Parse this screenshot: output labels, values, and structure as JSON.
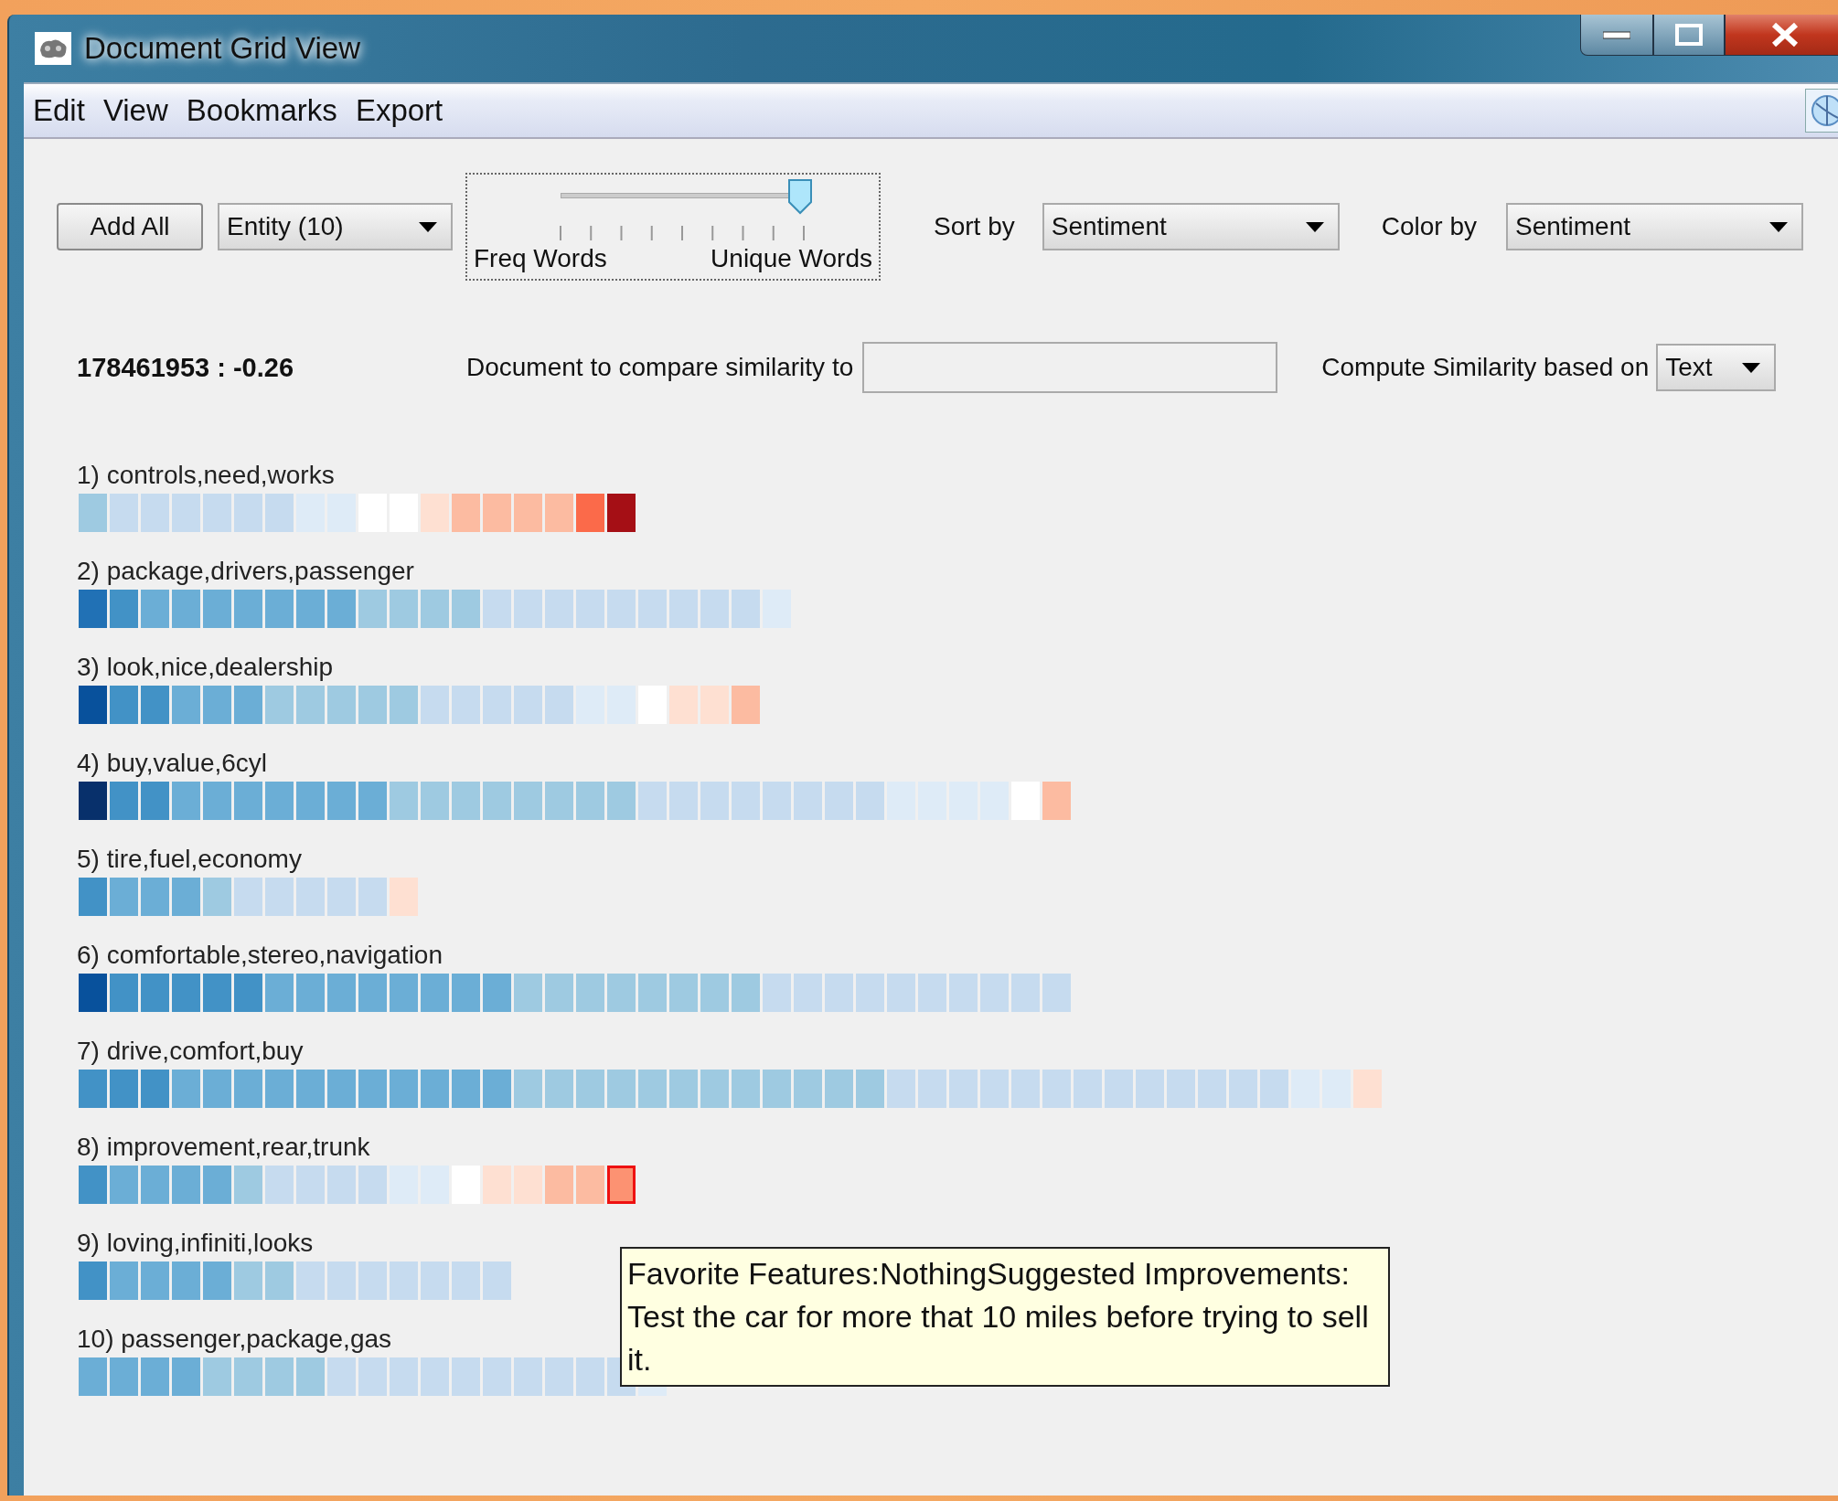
{
  "window": {
    "title": "Document Grid View"
  },
  "menu": [
    "Edit",
    "View",
    "Bookmarks",
    "Export"
  ],
  "toolbar": {
    "add_button": "Add All",
    "entity_dropdown": {
      "value": "Entity (10)"
    },
    "slider": {
      "left_label": "Freq Words",
      "right_label": "Unique Words",
      "level": 0.89
    },
    "sort_label": "Sort by",
    "sort_dropdown": {
      "value": "Sentiment"
    },
    "color_label": "Color by",
    "color_dropdown": {
      "value": "Sentiment"
    }
  },
  "info": {
    "document_score": "178461953 : -0.26",
    "compare_label": "Document to compare similarity to",
    "similarity_label": "Compute Similarity based on",
    "similarity_dropdown": {
      "value": "Text"
    }
  },
  "rows": [
    {
      "label": "1) controls,need,works",
      "cells": [
        {
          "color": "#9ecae1",
          "selected": false
        },
        {
          "color": "#c6dbef",
          "selected": false
        },
        {
          "color": "#c6dbef",
          "selected": false
        },
        {
          "color": "#c6dbef",
          "selected": false
        },
        {
          "color": "#c6dbef",
          "selected": false
        },
        {
          "color": "#c6dbef",
          "selected": false
        },
        {
          "color": "#c6dbef",
          "selected": false
        },
        {
          "color": "#deebf7",
          "selected": false
        },
        {
          "color": "#deebf7",
          "selected": false
        },
        {
          "color": "#ffffff",
          "selected": false
        },
        {
          "color": "#ffffff",
          "selected": false
        },
        {
          "color": "#fee0d2",
          "selected": false
        },
        {
          "color": "#fcbba1",
          "selected": false
        },
        {
          "color": "#fcbba1",
          "selected": false
        },
        {
          "color": "#fcbba1",
          "selected": false
        },
        {
          "color": "#fcbba1",
          "selected": false
        },
        {
          "color": "#fb6a4a",
          "selected": false
        },
        {
          "color": "#a50f15",
          "selected": false
        }
      ]
    },
    {
      "label": "2) package,drivers,passenger",
      "cells": [
        {
          "color": "#2171b5",
          "selected": false
        },
        {
          "color": "#4292c6",
          "selected": false
        },
        {
          "color": "#6baed6",
          "selected": false
        },
        {
          "color": "#6baed6",
          "selected": false
        },
        {
          "color": "#6baed6",
          "selected": false
        },
        {
          "color": "#6baed6",
          "selected": false
        },
        {
          "color": "#6baed6",
          "selected": false
        },
        {
          "color": "#6baed6",
          "selected": false
        },
        {
          "color": "#6baed6",
          "selected": false
        },
        {
          "color": "#9ecae1",
          "selected": false
        },
        {
          "color": "#9ecae1",
          "selected": false
        },
        {
          "color": "#9ecae1",
          "selected": false
        },
        {
          "color": "#9ecae1",
          "selected": false
        },
        {
          "color": "#c6dbef",
          "selected": false
        },
        {
          "color": "#c6dbef",
          "selected": false
        },
        {
          "color": "#c6dbef",
          "selected": false
        },
        {
          "color": "#c6dbef",
          "selected": false
        },
        {
          "color": "#c6dbef",
          "selected": false
        },
        {
          "color": "#c6dbef",
          "selected": false
        },
        {
          "color": "#c6dbef",
          "selected": false
        },
        {
          "color": "#c6dbef",
          "selected": false
        },
        {
          "color": "#c6dbef",
          "selected": false
        },
        {
          "color": "#deebf7",
          "selected": false
        }
      ]
    },
    {
      "label": "3) look,nice,dealership",
      "cells": [
        {
          "color": "#08519c",
          "selected": false
        },
        {
          "color": "#4292c6",
          "selected": false
        },
        {
          "color": "#4292c6",
          "selected": false
        },
        {
          "color": "#6baed6",
          "selected": false
        },
        {
          "color": "#6baed6",
          "selected": false
        },
        {
          "color": "#6baed6",
          "selected": false
        },
        {
          "color": "#9ecae1",
          "selected": false
        },
        {
          "color": "#9ecae1",
          "selected": false
        },
        {
          "color": "#9ecae1",
          "selected": false
        },
        {
          "color": "#9ecae1",
          "selected": false
        },
        {
          "color": "#9ecae1",
          "selected": false
        },
        {
          "color": "#c6dbef",
          "selected": false
        },
        {
          "color": "#c6dbef",
          "selected": false
        },
        {
          "color": "#c6dbef",
          "selected": false
        },
        {
          "color": "#c6dbef",
          "selected": false
        },
        {
          "color": "#c6dbef",
          "selected": false
        },
        {
          "color": "#deebf7",
          "selected": false
        },
        {
          "color": "#deebf7",
          "selected": false
        },
        {
          "color": "#ffffff",
          "selected": false
        },
        {
          "color": "#fee0d2",
          "selected": false
        },
        {
          "color": "#fee0d2",
          "selected": false
        },
        {
          "color": "#fcbba1",
          "selected": false
        }
      ]
    },
    {
      "label": "4) buy,value,6cyl",
      "cells": [
        {
          "color": "#08306b",
          "selected": false
        },
        {
          "color": "#4292c6",
          "selected": false
        },
        {
          "color": "#4292c6",
          "selected": false
        },
        {
          "color": "#6baed6",
          "selected": false
        },
        {
          "color": "#6baed6",
          "selected": false
        },
        {
          "color": "#6baed6",
          "selected": false
        },
        {
          "color": "#6baed6",
          "selected": false
        },
        {
          "color": "#6baed6",
          "selected": false
        },
        {
          "color": "#6baed6",
          "selected": false
        },
        {
          "color": "#6baed6",
          "selected": false
        },
        {
          "color": "#9ecae1",
          "selected": false
        },
        {
          "color": "#9ecae1",
          "selected": false
        },
        {
          "color": "#9ecae1",
          "selected": false
        },
        {
          "color": "#9ecae1",
          "selected": false
        },
        {
          "color": "#9ecae1",
          "selected": false
        },
        {
          "color": "#9ecae1",
          "selected": false
        },
        {
          "color": "#9ecae1",
          "selected": false
        },
        {
          "color": "#9ecae1",
          "selected": false
        },
        {
          "color": "#c6dbef",
          "selected": false
        },
        {
          "color": "#c6dbef",
          "selected": false
        },
        {
          "color": "#c6dbef",
          "selected": false
        },
        {
          "color": "#c6dbef",
          "selected": false
        },
        {
          "color": "#c6dbef",
          "selected": false
        },
        {
          "color": "#c6dbef",
          "selected": false
        },
        {
          "color": "#c6dbef",
          "selected": false
        },
        {
          "color": "#c6dbef",
          "selected": false
        },
        {
          "color": "#deebf7",
          "selected": false
        },
        {
          "color": "#deebf7",
          "selected": false
        },
        {
          "color": "#deebf7",
          "selected": false
        },
        {
          "color": "#deebf7",
          "selected": false
        },
        {
          "color": "#ffffff",
          "selected": false
        },
        {
          "color": "#fcbba1",
          "selected": false
        }
      ]
    },
    {
      "label": "5) tire,fuel,economy",
      "cells": [
        {
          "color": "#4292c6",
          "selected": false
        },
        {
          "color": "#6baed6",
          "selected": false
        },
        {
          "color": "#6baed6",
          "selected": false
        },
        {
          "color": "#6baed6",
          "selected": false
        },
        {
          "color": "#9ecae1",
          "selected": false
        },
        {
          "color": "#c6dbef",
          "selected": false
        },
        {
          "color": "#c6dbef",
          "selected": false
        },
        {
          "color": "#c6dbef",
          "selected": false
        },
        {
          "color": "#c6dbef",
          "selected": false
        },
        {
          "color": "#c6dbef",
          "selected": false
        },
        {
          "color": "#fee0d2",
          "selected": false
        }
      ]
    },
    {
      "label": "6) comfortable,stereo,navigation",
      "cells": [
        {
          "color": "#08519c",
          "selected": false
        },
        {
          "color": "#4292c6",
          "selected": false
        },
        {
          "color": "#4292c6",
          "selected": false
        },
        {
          "color": "#4292c6",
          "selected": false
        },
        {
          "color": "#4292c6",
          "selected": false
        },
        {
          "color": "#4292c6",
          "selected": false
        },
        {
          "color": "#6baed6",
          "selected": false
        },
        {
          "color": "#6baed6",
          "selected": false
        },
        {
          "color": "#6baed6",
          "selected": false
        },
        {
          "color": "#6baed6",
          "selected": false
        },
        {
          "color": "#6baed6",
          "selected": false
        },
        {
          "color": "#6baed6",
          "selected": false
        },
        {
          "color": "#6baed6",
          "selected": false
        },
        {
          "color": "#6baed6",
          "selected": false
        },
        {
          "color": "#9ecae1",
          "selected": false
        },
        {
          "color": "#9ecae1",
          "selected": false
        },
        {
          "color": "#9ecae1",
          "selected": false
        },
        {
          "color": "#9ecae1",
          "selected": false
        },
        {
          "color": "#9ecae1",
          "selected": false
        },
        {
          "color": "#9ecae1",
          "selected": false
        },
        {
          "color": "#9ecae1",
          "selected": false
        },
        {
          "color": "#9ecae1",
          "selected": false
        },
        {
          "color": "#c6dbef",
          "selected": false
        },
        {
          "color": "#c6dbef",
          "selected": false
        },
        {
          "color": "#c6dbef",
          "selected": false
        },
        {
          "color": "#c6dbef",
          "selected": false
        },
        {
          "color": "#c6dbef",
          "selected": false
        },
        {
          "color": "#c6dbef",
          "selected": false
        },
        {
          "color": "#c6dbef",
          "selected": false
        },
        {
          "color": "#c6dbef",
          "selected": false
        },
        {
          "color": "#c6dbef",
          "selected": false
        },
        {
          "color": "#c6dbef",
          "selected": false
        }
      ]
    },
    {
      "label": "7) drive,comfort,buy",
      "cells": [
        {
          "color": "#4292c6",
          "selected": false
        },
        {
          "color": "#4292c6",
          "selected": false
        },
        {
          "color": "#4292c6",
          "selected": false
        },
        {
          "color": "#6baed6",
          "selected": false
        },
        {
          "color": "#6baed6",
          "selected": false
        },
        {
          "color": "#6baed6",
          "selected": false
        },
        {
          "color": "#6baed6",
          "selected": false
        },
        {
          "color": "#6baed6",
          "selected": false
        },
        {
          "color": "#6baed6",
          "selected": false
        },
        {
          "color": "#6baed6",
          "selected": false
        },
        {
          "color": "#6baed6",
          "selected": false
        },
        {
          "color": "#6baed6",
          "selected": false
        },
        {
          "color": "#6baed6",
          "selected": false
        },
        {
          "color": "#6baed6",
          "selected": false
        },
        {
          "color": "#9ecae1",
          "selected": false
        },
        {
          "color": "#9ecae1",
          "selected": false
        },
        {
          "color": "#9ecae1",
          "selected": false
        },
        {
          "color": "#9ecae1",
          "selected": false
        },
        {
          "color": "#9ecae1",
          "selected": false
        },
        {
          "color": "#9ecae1",
          "selected": false
        },
        {
          "color": "#9ecae1",
          "selected": false
        },
        {
          "color": "#9ecae1",
          "selected": false
        },
        {
          "color": "#9ecae1",
          "selected": false
        },
        {
          "color": "#9ecae1",
          "selected": false
        },
        {
          "color": "#9ecae1",
          "selected": false
        },
        {
          "color": "#9ecae1",
          "selected": false
        },
        {
          "color": "#c6dbef",
          "selected": false
        },
        {
          "color": "#c6dbef",
          "selected": false
        },
        {
          "color": "#c6dbef",
          "selected": false
        },
        {
          "color": "#c6dbef",
          "selected": false
        },
        {
          "color": "#c6dbef",
          "selected": false
        },
        {
          "color": "#c6dbef",
          "selected": false
        },
        {
          "color": "#c6dbef",
          "selected": false
        },
        {
          "color": "#c6dbef",
          "selected": false
        },
        {
          "color": "#c6dbef",
          "selected": false
        },
        {
          "color": "#c6dbef",
          "selected": false
        },
        {
          "color": "#c6dbef",
          "selected": false
        },
        {
          "color": "#c6dbef",
          "selected": false
        },
        {
          "color": "#c6dbef",
          "selected": false
        },
        {
          "color": "#deebf7",
          "selected": false
        },
        {
          "color": "#deebf7",
          "selected": false
        },
        {
          "color": "#fee0d2",
          "selected": false
        }
      ]
    },
    {
      "label": "8) improvement,rear,trunk",
      "cells": [
        {
          "color": "#4292c6",
          "selected": false
        },
        {
          "color": "#6baed6",
          "selected": false
        },
        {
          "color": "#6baed6",
          "selected": false
        },
        {
          "color": "#6baed6",
          "selected": false
        },
        {
          "color": "#6baed6",
          "selected": false
        },
        {
          "color": "#9ecae1",
          "selected": false
        },
        {
          "color": "#c6dbef",
          "selected": false
        },
        {
          "color": "#c6dbef",
          "selected": false
        },
        {
          "color": "#c6dbef",
          "selected": false
        },
        {
          "color": "#c6dbef",
          "selected": false
        },
        {
          "color": "#deebf7",
          "selected": false
        },
        {
          "color": "#deebf7",
          "selected": false
        },
        {
          "color": "#ffffff",
          "selected": false
        },
        {
          "color": "#fee0d2",
          "selected": false
        },
        {
          "color": "#fee0d2",
          "selected": false
        },
        {
          "color": "#fcbba1",
          "selected": false
        },
        {
          "color": "#fcbba1",
          "selected": false
        },
        {
          "color": "#fc9272",
          "selected": true
        }
      ]
    },
    {
      "label": "9) loving,infiniti,looks",
      "cells": [
        {
          "color": "#4292c6",
          "selected": false
        },
        {
          "color": "#6baed6",
          "selected": false
        },
        {
          "color": "#6baed6",
          "selected": false
        },
        {
          "color": "#6baed6",
          "selected": false
        },
        {
          "color": "#6baed6",
          "selected": false
        },
        {
          "color": "#9ecae1",
          "selected": false
        },
        {
          "color": "#9ecae1",
          "selected": false
        },
        {
          "color": "#c6dbef",
          "selected": false
        },
        {
          "color": "#c6dbef",
          "selected": false
        },
        {
          "color": "#c6dbef",
          "selected": false
        },
        {
          "color": "#c6dbef",
          "selected": false
        },
        {
          "color": "#c6dbef",
          "selected": false
        },
        {
          "color": "#c6dbef",
          "selected": false
        },
        {
          "color": "#c6dbef",
          "selected": false
        }
      ]
    },
    {
      "label": "10) passenger,package,gas",
      "cells": [
        {
          "color": "#6baed6",
          "selected": false
        },
        {
          "color": "#6baed6",
          "selected": false
        },
        {
          "color": "#6baed6",
          "selected": false
        },
        {
          "color": "#6baed6",
          "selected": false
        },
        {
          "color": "#9ecae1",
          "selected": false
        },
        {
          "color": "#9ecae1",
          "selected": false
        },
        {
          "color": "#9ecae1",
          "selected": false
        },
        {
          "color": "#9ecae1",
          "selected": false
        },
        {
          "color": "#c6dbef",
          "selected": false
        },
        {
          "color": "#c6dbef",
          "selected": false
        },
        {
          "color": "#c6dbef",
          "selected": false
        },
        {
          "color": "#c6dbef",
          "selected": false
        },
        {
          "color": "#c6dbef",
          "selected": false
        },
        {
          "color": "#c6dbef",
          "selected": false
        },
        {
          "color": "#c6dbef",
          "selected": false
        },
        {
          "color": "#c6dbef",
          "selected": false
        },
        {
          "color": "#c6dbef",
          "selected": false
        },
        {
          "color": "#c6dbef",
          "selected": false
        },
        {
          "color": "#deebf7",
          "selected": false
        }
      ]
    }
  ],
  "tooltip": {
    "text": "Favorite Features:NothingSuggested Improvements: Test the car for more that 10 miles before trying to sell it."
  }
}
